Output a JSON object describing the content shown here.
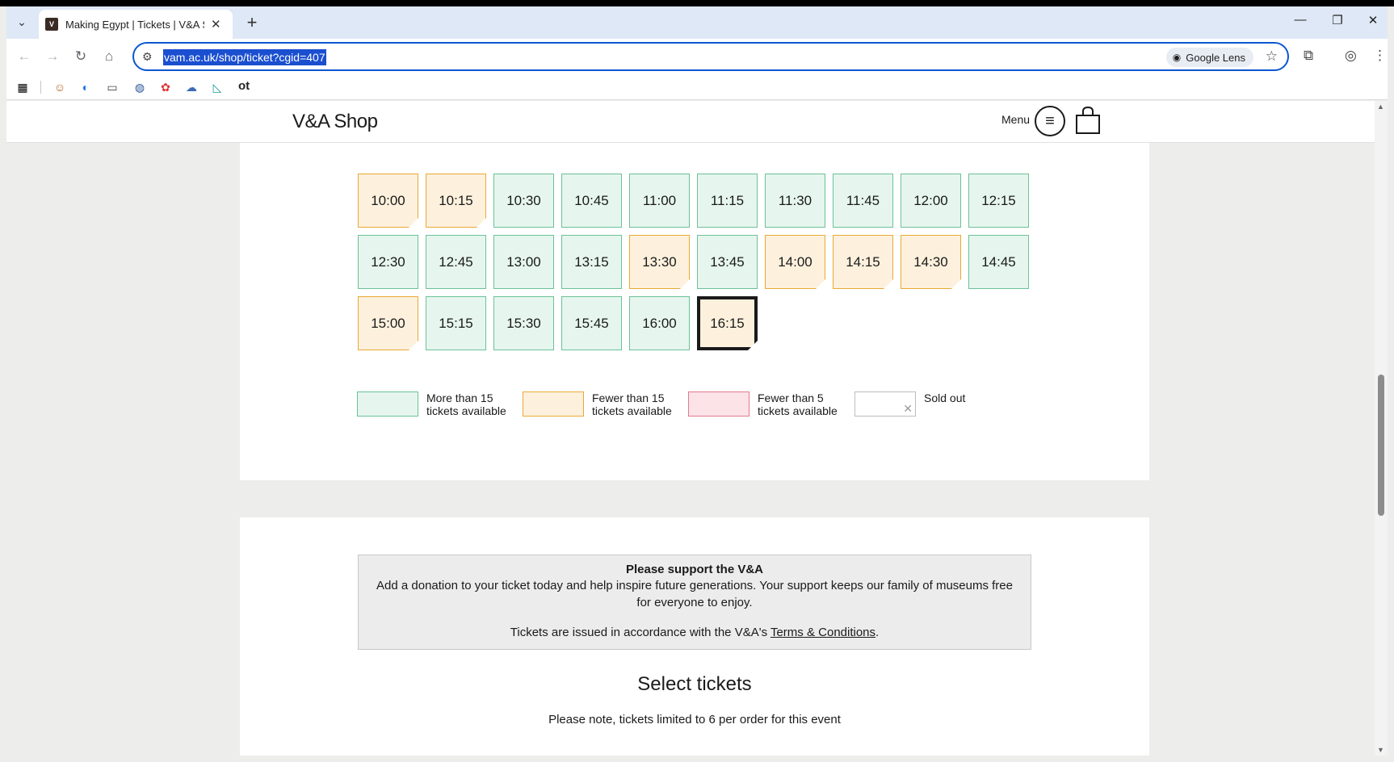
{
  "browser": {
    "tab_title": "Making Egypt | Tickets | V&A Sh",
    "tab_close": "✕",
    "new_tab": "+",
    "url": "vam.ac.uk/shop/ticket?cgid=407",
    "lens_label": "Google Lens",
    "bookmark_text": "ot"
  },
  "site": {
    "logo": "V&A Shop",
    "menu_label": "Menu"
  },
  "slots": [
    {
      "time": "10:00",
      "status": "fewer15"
    },
    {
      "time": "10:15",
      "status": "fewer15"
    },
    {
      "time": "10:30",
      "status": "more15"
    },
    {
      "time": "10:45",
      "status": "more15"
    },
    {
      "time": "11:00",
      "status": "more15"
    },
    {
      "time": "11:15",
      "status": "more15"
    },
    {
      "time": "11:30",
      "status": "more15"
    },
    {
      "time": "11:45",
      "status": "more15"
    },
    {
      "time": "12:00",
      "status": "more15"
    },
    {
      "time": "12:15",
      "status": "more15"
    },
    {
      "time": "12:30",
      "status": "more15"
    },
    {
      "time": "12:45",
      "status": "more15"
    },
    {
      "time": "13:00",
      "status": "more15"
    },
    {
      "time": "13:15",
      "status": "more15"
    },
    {
      "time": "13:30",
      "status": "fewer15"
    },
    {
      "time": "13:45",
      "status": "more15"
    },
    {
      "time": "14:00",
      "status": "fewer15"
    },
    {
      "time": "14:15",
      "status": "fewer15"
    },
    {
      "time": "14:30",
      "status": "fewer15"
    },
    {
      "time": "14:45",
      "status": "more15"
    },
    {
      "time": "15:00",
      "status": "fewer15"
    },
    {
      "time": "15:15",
      "status": "more15"
    },
    {
      "time": "15:30",
      "status": "more15"
    },
    {
      "time": "15:45",
      "status": "more15"
    },
    {
      "time": "16:00",
      "status": "more15"
    },
    {
      "time": "16:15",
      "status": "fewer15",
      "selected": true
    }
  ],
  "legend": {
    "more": "More than 15 tickets available",
    "fewer15": "Fewer than 15 tickets available",
    "fewer5": "Fewer than 5 tickets available",
    "sold": "Sold out",
    "sold_mark": "✕"
  },
  "support": {
    "heading": "Please support the V&A",
    "body": "Add a donation to your ticket today and help inspire future generations. Your support keeps our family of museums free for everyone to enjoy.",
    "terms_prefix": "Tickets are issued in accordance with the V&A's ",
    "terms_link": "Terms & Conditions",
    "terms_suffix": "."
  },
  "select": {
    "title": "Select tickets",
    "note": "Please note, tickets limited to 6 per order for this event"
  },
  "colors": {
    "more15_border": "#6cc197",
    "more15_fill": "#e6f6ee",
    "fewer15_border": "#e9a935",
    "fewer15_fill": "#fdf1dd",
    "fewer5_border": "#e37a8c",
    "fewer5_fill": "#fbe3e7"
  }
}
